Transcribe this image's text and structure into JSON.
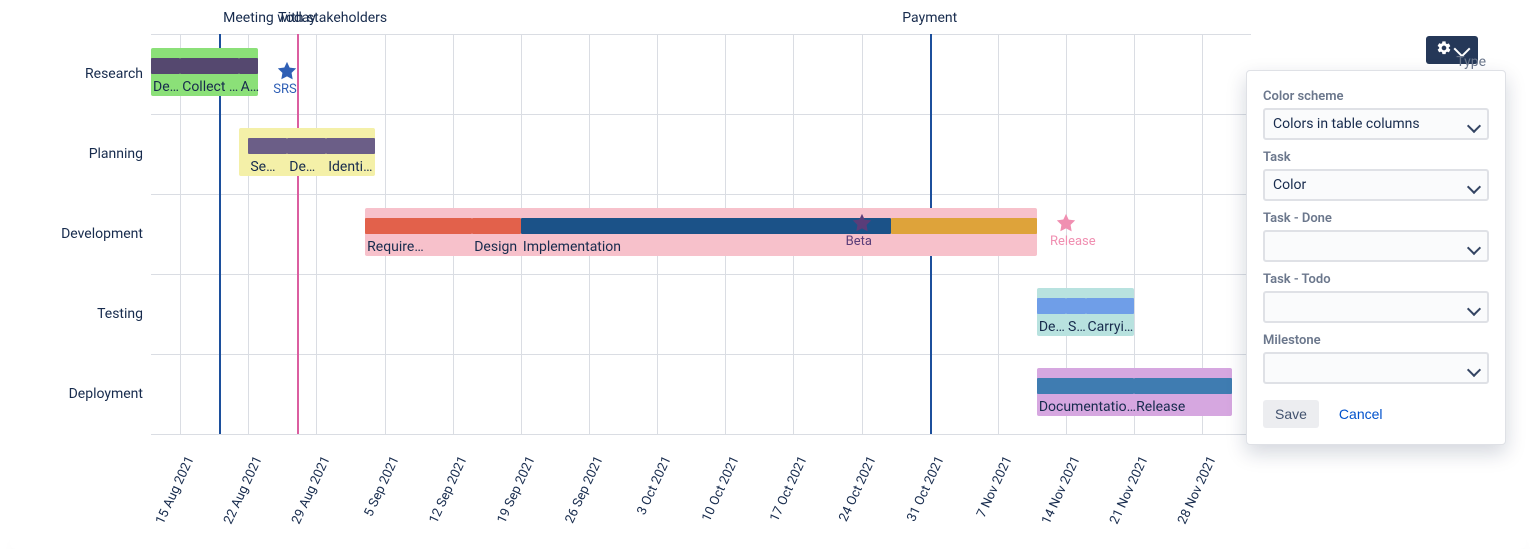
{
  "timeline": {
    "start": "2021-08-12",
    "end": "2021-12-03",
    "ticks": [
      "15 Aug 2021",
      "22 Aug 2021",
      "29 Aug 2021",
      "5 Sep 2021",
      "12 Sep 2021",
      "19 Sep 2021",
      "26 Sep 2021",
      "3 Oct 2021",
      "10 Oct 2021",
      "17 Oct 2021",
      "24 Oct 2021",
      "31 Oct 2021",
      "7 Nov 2021",
      "14 Nov 2021",
      "21 Nov 2021",
      "28 Nov 2021"
    ]
  },
  "rows": [
    {
      "label": "Research"
    },
    {
      "label": "Planning"
    },
    {
      "label": "Development"
    },
    {
      "label": "Testing"
    },
    {
      "label": "Deployment"
    }
  ],
  "markers": [
    {
      "id": "meeting",
      "date": "2021-08-19",
      "label": "Meeting with stakeholders",
      "kind": "blue",
      "label_align": "left"
    },
    {
      "id": "today",
      "date": "2021-08-27",
      "label": "Today",
      "kind": "today",
      "label_align": "center"
    },
    {
      "id": "payment",
      "date": "2021-10-31",
      "label": "Payment",
      "kind": "blue",
      "label_align": "center"
    }
  ],
  "milestones": [
    {
      "id": "srs",
      "row": 0,
      "date": "2021-08-26",
      "label": "SRS",
      "color": "#2f5fb5"
    },
    {
      "id": "beta",
      "row": 2,
      "date": "2021-10-24",
      "label": "Beta",
      "color": "#5a3d79"
    },
    {
      "id": "release",
      "row": 2,
      "date": "2021-11-14",
      "label": "Release",
      "color": "#f08fb1"
    }
  ],
  "chart_data": {
    "type": "gantt",
    "x_range": [
      "2021-08-12",
      "2021-12-03"
    ],
    "rows": [
      "Research",
      "Planning",
      "Development",
      "Testing",
      "Deployment"
    ],
    "groups": [
      {
        "row": 0,
        "name": "Research",
        "start": "2021-08-12",
        "end": "2021-08-23",
        "group_color": "#8be078",
        "subtasks": [
          {
            "label": "De…",
            "start": "2021-08-12",
            "end": "2021-08-15",
            "color": "#55486f"
          },
          {
            "label": "Collect …",
            "start": "2021-08-15",
            "end": "2021-08-21",
            "color": "#55486f"
          },
          {
            "label": "A…",
            "start": "2021-08-21",
            "end": "2021-08-23",
            "color": "#55486f"
          }
        ]
      },
      {
        "row": 1,
        "name": "Planning",
        "start": "2021-08-21",
        "end": "2021-09-04",
        "group_color": "#f4f0a8",
        "subtasks": [
          {
            "label": "Se…",
            "start": "2021-08-22",
            "end": "2021-08-26",
            "color": "#6b5e87"
          },
          {
            "label": "De…",
            "start": "2021-08-26",
            "end": "2021-08-30",
            "color": "#6b5e87"
          },
          {
            "label": "Identif…",
            "start": "2021-08-30",
            "end": "2021-09-04",
            "color": "#6b5e87"
          }
        ]
      },
      {
        "row": 2,
        "name": "Development",
        "start": "2021-09-03",
        "end": "2021-11-11",
        "group_color": "#f7c1cb",
        "subtasks": [
          {
            "label": "Require…",
            "start": "2021-09-03",
            "end": "2021-09-14",
            "color": "#e2614b"
          },
          {
            "label": "Design",
            "start": "2021-09-14",
            "end": "2021-09-19",
            "color": "#e2614b"
          },
          {
            "label": "Implementation",
            "start": "2021-09-19",
            "end": "2021-10-27",
            "color": "#1b5288"
          },
          {
            "label": "",
            "start": "2021-10-27",
            "end": "2021-11-11",
            "color": "#dea33a"
          }
        ]
      },
      {
        "row": 3,
        "name": "Testing",
        "start": "2021-11-11",
        "end": "2021-11-21",
        "group_color": "#b8e2df",
        "subtasks": [
          {
            "label": "De…",
            "start": "2021-11-11",
            "end": "2021-11-14",
            "color": "#6f9ee8"
          },
          {
            "label": "S…",
            "start": "2021-11-14",
            "end": "2021-11-16",
            "color": "#6f9ee8"
          },
          {
            "label": "Carryi…",
            "start": "2021-11-16",
            "end": "2021-11-21",
            "color": "#6f9ee8"
          }
        ]
      },
      {
        "row": 4,
        "name": "Deployment",
        "start": "2021-11-11",
        "end": "2021-12-01",
        "group_color": "#d6a7e0",
        "subtasks": [
          {
            "label": "Documentatio…",
            "start": "2021-11-11",
            "end": "2021-11-21",
            "color": "#3f7cb1"
          },
          {
            "label": "Release",
            "start": "2021-11-21",
            "end": "2021-12-01",
            "color": "#3f7cb1"
          }
        ]
      }
    ]
  },
  "popover": {
    "behind_label": "Type",
    "fields": {
      "color_scheme": {
        "label": "Color scheme",
        "value": "Colors in table columns"
      },
      "task": {
        "label": "Task",
        "value": "Color"
      },
      "task_done": {
        "label": "Task - Done",
        "value": ""
      },
      "task_todo": {
        "label": "Task - Todo",
        "value": ""
      },
      "milestone": {
        "label": "Milestone",
        "value": ""
      }
    },
    "actions": {
      "save": "Save",
      "cancel": "Cancel"
    }
  }
}
